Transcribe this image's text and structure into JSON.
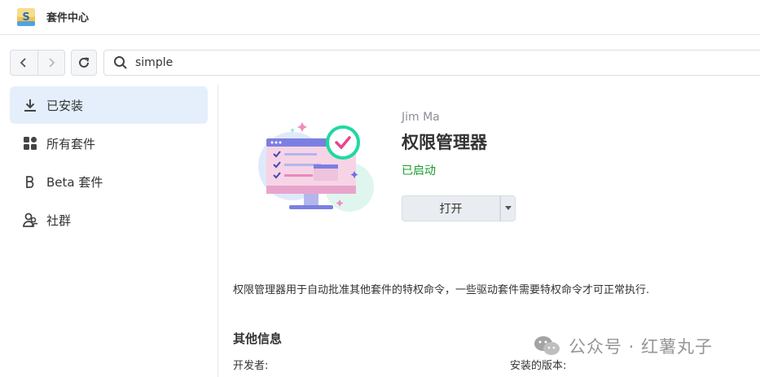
{
  "window": {
    "title": "套件中心"
  },
  "toolbar": {
    "search_value": "simple"
  },
  "sidebar": {
    "items": [
      {
        "label": "已安装",
        "icon": "download-icon",
        "active": true
      },
      {
        "label": "所有套件",
        "icon": "grid-icon",
        "active": false
      },
      {
        "label": "Beta 套件",
        "icon": "beta-icon",
        "active": false
      },
      {
        "label": "社群",
        "icon": "community-icon",
        "active": false
      }
    ]
  },
  "package": {
    "developer": "Jim Ma",
    "name": "权限管理器",
    "status": "已启动",
    "status_color": "#1a9c2e",
    "open_label": "打开",
    "description": "权限管理器用于自动批准其他套件的特权命令，一些驱动套件需要特权命令才可正常执行.",
    "info_title": "其他信息",
    "developer_label": "开发者:",
    "version_label": "安装的版本:"
  },
  "watermark": {
    "text": "公众号 · 红薯丸子"
  },
  "colors": {
    "accent": "#0b6fd8",
    "active_bg": "#e4effb"
  }
}
